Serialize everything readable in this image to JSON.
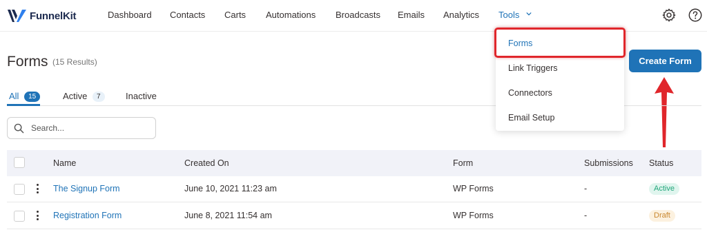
{
  "brand": {
    "logo_text": "FunnelKit"
  },
  "nav": {
    "items": [
      {
        "label": "Dashboard"
      },
      {
        "label": "Contacts"
      },
      {
        "label": "Carts"
      },
      {
        "label": "Automations"
      },
      {
        "label": "Broadcasts"
      },
      {
        "label": "Emails"
      },
      {
        "label": "Analytics"
      },
      {
        "label": "Tools"
      }
    ],
    "active": "Tools"
  },
  "tools_menu": {
    "items": [
      {
        "label": "Forms"
      },
      {
        "label": "Link Triggers"
      },
      {
        "label": "Connectors"
      },
      {
        "label": "Email Setup"
      }
    ],
    "selected": "Forms"
  },
  "page": {
    "title": "Forms",
    "result_count": "(15 Results)",
    "create_button": "Create Form"
  },
  "tabs": [
    {
      "label": "All",
      "count": "15"
    },
    {
      "label": "Active",
      "count": "7"
    },
    {
      "label": "Inactive",
      "count": ""
    }
  ],
  "search": {
    "placeholder": "Search...",
    "value": ""
  },
  "table": {
    "columns": [
      "Name",
      "Created On",
      "Form",
      "Submissions",
      "Status"
    ],
    "rows": [
      {
        "name": "The Signup Form",
        "created_on": "June 10, 2021 11:23 am",
        "form": "WP Forms",
        "submissions": "-",
        "status": "Active"
      },
      {
        "name": "Registration Form",
        "created_on": "June 8, 2021 11:54 am",
        "form": "WP Forms",
        "submissions": "-",
        "status": "Draft"
      }
    ]
  },
  "colors": {
    "accent": "#1f73b7",
    "annotation_red": "#e0262b",
    "status_active": "#21a67a",
    "status_draft": "#c8862d"
  },
  "icons": {
    "settings": "gear-icon",
    "help": "help-circle-icon",
    "search": "search-icon",
    "dropdown": "chevron-down-icon",
    "row_menu": "kebab-icon"
  }
}
